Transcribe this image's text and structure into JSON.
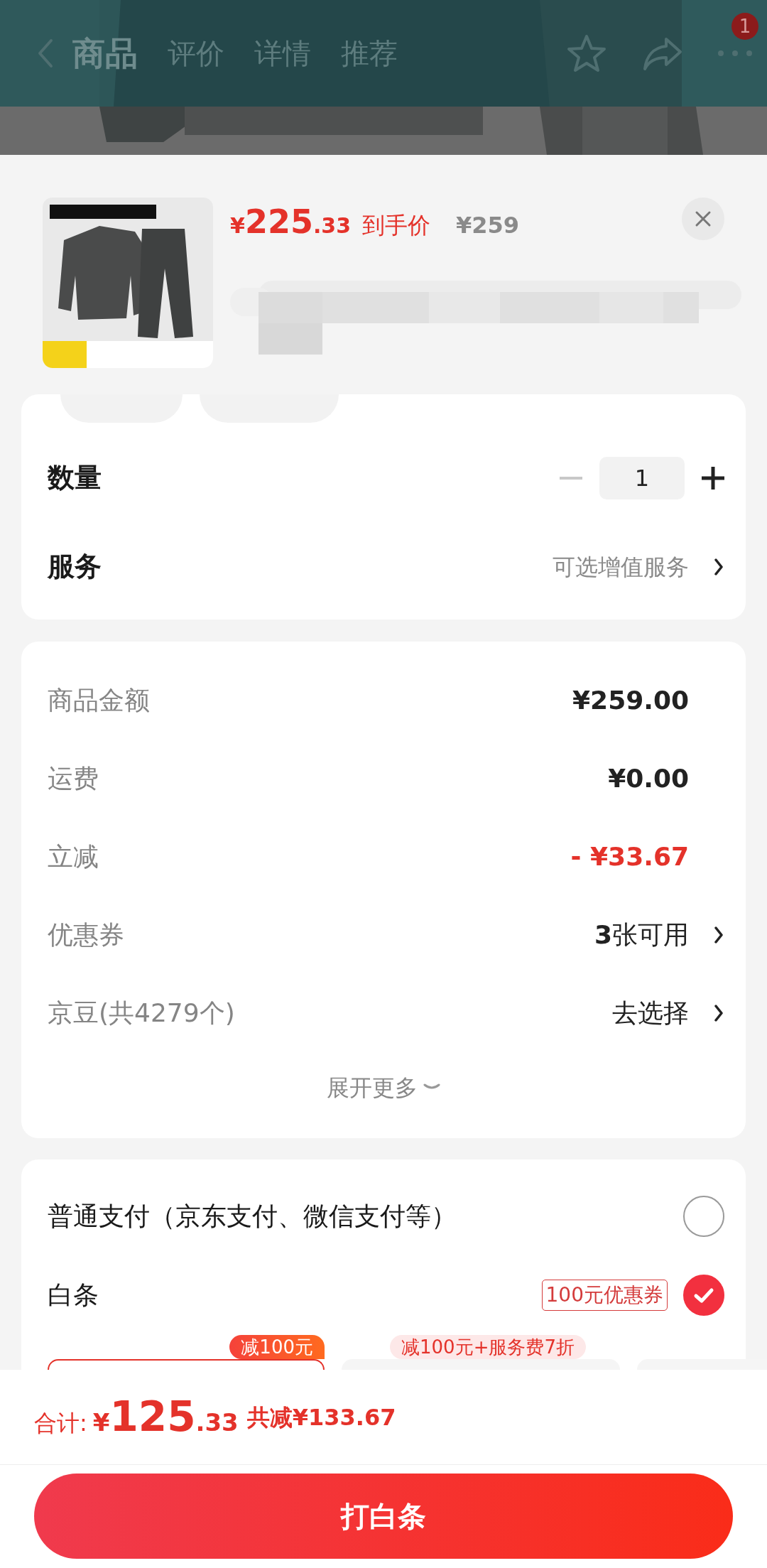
{
  "background_page": {
    "tabs": [
      {
        "label": "商品",
        "selected": true
      },
      {
        "label": "评价",
        "selected": false
      },
      {
        "label": "详情",
        "selected": false
      },
      {
        "label": "推荐",
        "selected": false
      }
    ],
    "message_badge": "1"
  },
  "product": {
    "price": "¥225.33",
    "price_label": "到手价",
    "original_price": "¥259"
  },
  "quantity": {
    "label": "数量",
    "value": "1",
    "decrease_disabled": true
  },
  "service": {
    "label": "服务",
    "value": "可选增值服务"
  },
  "summary": {
    "rows": [
      {
        "label": "商品金额",
        "value": "¥259.00",
        "kind": "amount"
      },
      {
        "label": "运费",
        "value": "¥0.00",
        "kind": "amount"
      },
      {
        "label": "立减",
        "value": "- ¥33.67",
        "kind": "discount"
      },
      {
        "label": "优惠券",
        "value": "**3**张可用",
        "kind": "link"
      },
      {
        "label": "京豆(共4279个)",
        "value": "去选择",
        "kind": "link"
      }
    ],
    "expand": "展开更多"
  },
  "payment": {
    "options": [
      {
        "label": "普通支付（京东支付、微信支付等）",
        "selected": false
      },
      {
        "label": "白条",
        "tag": "100元优惠券",
        "selected": true
      }
    ],
    "plans": [
      {
        "tag": "减100元",
        "selected": true
      },
      {
        "tag": "减100元+服务费7折",
        "selected": false
      },
      {
        "selected": false
      }
    ]
  },
  "footer": {
    "total_label": "合计:",
    "total": "¥125.33",
    "saving": "共减¥133.67",
    "button": "打白条"
  }
}
